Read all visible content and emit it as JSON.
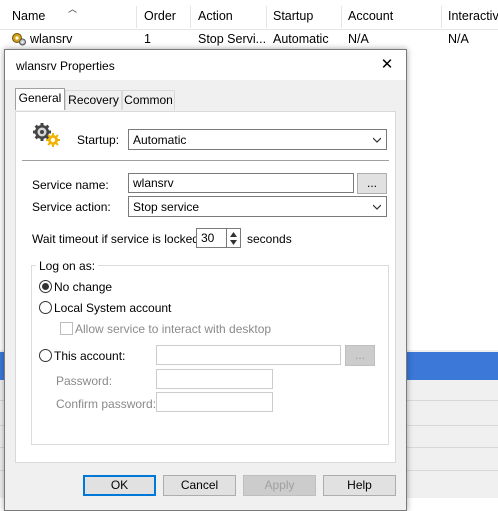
{
  "background_list": {
    "columns": [
      "Name",
      "Order",
      "Action",
      "Startup",
      "Account",
      "Interactiv"
    ],
    "row": {
      "name": "wlansrv",
      "order": "1",
      "action": "Stop Servi...",
      "startup": "Automatic",
      "account": "N/A",
      "interactive": "N/A"
    }
  },
  "dialog": {
    "title": "wlansrv Properties",
    "close_glyph": "✕",
    "tabs": [
      "General",
      "Recovery",
      "Common"
    ],
    "startup_label": "Startup:",
    "startup_value": "Automatic",
    "service_name_label": "Service name:",
    "service_name_value": "wlansrv",
    "browse_label": "...",
    "service_action_label": "Service action:",
    "service_action_value": "Stop service",
    "wait_label": "Wait timeout if service is locked:",
    "wait_value": "30",
    "wait_unit": "seconds",
    "logon_group_label": "Log on as:",
    "radio_no_change": "No change",
    "radio_local_system": "Local System account",
    "checkbox_interact": "Allow service to interact with desktop",
    "radio_this_account": "This account:",
    "account_browse_label": "...",
    "password_label": "Password:",
    "confirm_password_label": "Confirm password:",
    "buttons": {
      "ok": "OK",
      "cancel": "Cancel",
      "apply": "Apply",
      "help": "Help"
    },
    "selected_logon": "No change"
  },
  "colors": {
    "accent": "#0078d7",
    "selection_band": "#3c78d8"
  }
}
